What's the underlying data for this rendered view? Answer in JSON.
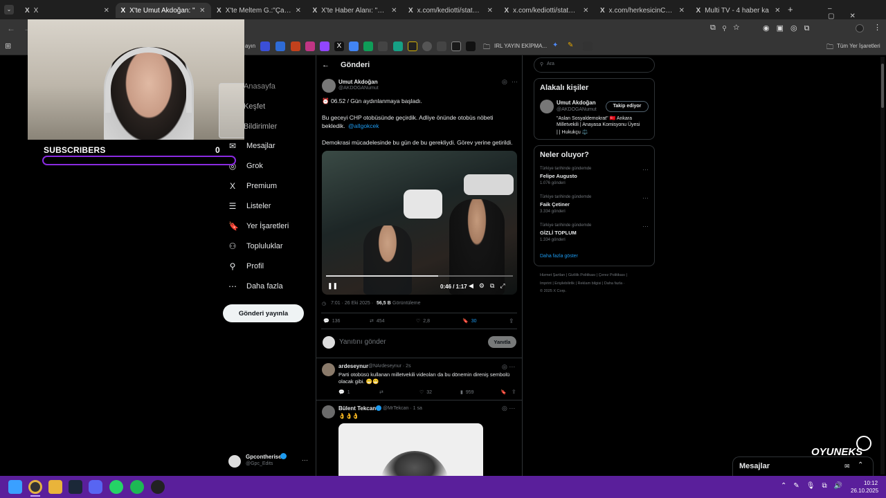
{
  "tabs": [
    {
      "label": "X"
    },
    {
      "label": "X'te Umut Akdoğan: \""
    },
    {
      "label": "X'te Meltem G.:\"Çağlayan"
    },
    {
      "label": "X'te Haber Alanı: \"CHP M"
    },
    {
      "label": "x.com/kediotti/status/19"
    },
    {
      "label": "x.com/kediotti/status/19"
    },
    {
      "label": "x.com/herkesicinCHP/sta"
    },
    {
      "label": "Multi TV - 4 haber ka"
    }
  ],
  "bookmarks": {
    "folder": "IRL YAYIN EKİPMA...",
    "all": "Tüm Yer İşaretleri",
    "truncated": "ayın"
  },
  "overlay": {
    "subscribers_label": "SUBSCRIBERS",
    "subscribers_count": "0",
    "brand": "OYUNEKS"
  },
  "sidebar": {
    "items": [
      {
        "label": "Anasayfa",
        "icon": "home-icon"
      },
      {
        "label": "Keşfet",
        "icon": "search-icon"
      },
      {
        "label": "Bildirimler",
        "icon": "bell-icon"
      },
      {
        "label": "Mesajlar",
        "icon": "mail-icon"
      },
      {
        "label": "Grok",
        "icon": "grok-icon"
      },
      {
        "label": "Premium",
        "icon": "x-icon"
      },
      {
        "label": "Listeler",
        "icon": "list-icon"
      },
      {
        "label": "Yer İşaretleri",
        "icon": "bookmark-icon"
      },
      {
        "label": "Topluluklar",
        "icon": "people-icon"
      },
      {
        "label": "Profil",
        "icon": "person-icon"
      },
      {
        "label": "Daha fazla",
        "icon": "more-icon"
      }
    ],
    "post_button": "Gönderi yayınla",
    "account": {
      "name": "Gpcontherise",
      "handle": "@Gpc_Edits"
    }
  },
  "header": {
    "title": "Gönderi"
  },
  "tweet": {
    "name": "Umut Akdoğan",
    "handle": "@AKDOGANumut",
    "line1": "⏰ 06.52 / Gün aydınlanmaya başladı.",
    "line2": "Bu geceyi CHP otobüsünde geçirdik. Adliye önünde otobüs nöbeti",
    "line3a": "bekledik.",
    "mention": "@alIgokcek",
    "line4": "Demokrasi mücadelesinde bu gün de bu gerekliydi. Görev yerine getirildi.",
    "video_time": "0:46 / 1:17",
    "video_progress": 0.6,
    "time": "7:01 · 26 Eki 2025 · ",
    "views": "56,5 B",
    "views_label": "Görüntüleme",
    "replies": "136",
    "retweets": "454",
    "likes": "2,8",
    "bookmarks": "30"
  },
  "reply_box": {
    "placeholder": "Yanıtını gönder",
    "button": "Yanıtla"
  },
  "replies": [
    {
      "name": "ardeseynur",
      "handle": "@NArdeseynur · 2s",
      "text1": "Parti otobüsü kullanan milletvekili videoları da bu dönemin direniş sembolü",
      "text2": "olacak gibi. 😁😁",
      "r": "1",
      "rt": "",
      "l": "32",
      "v": "959"
    },
    {
      "name": "Bülent Tekcan",
      "handle": "@MrTekcan · 1 sa",
      "text1": "👌👌👌"
    }
  ],
  "search": {
    "placeholder": "Ara"
  },
  "related": {
    "title": "Alakalı kişiler",
    "name": "Umut Akdoğan",
    "handle": "@AKDOGANumut",
    "button": "Takip ediyor",
    "bio1": "\"Aslan Sosyaldemokrat\" 🇹🇷 Ankara",
    "bio2": "Milletvekili | Anayasa Komisyonu Üyesi",
    "bio3": "| | Hukukçu ⚖️"
  },
  "trends": {
    "title": "Neler oluyor?",
    "items": [
      {
        "context": "Türkiye tarihinde gündemde",
        "name": "Felipe Augusto",
        "count": "1.076 gönderi"
      },
      {
        "context": "Türkiye tarihinde gündemde",
        "name": "Faik Çetiner",
        "count": "3.334 gönderi"
      },
      {
        "context": "Türkiye tarihinde gündemde",
        "name": "GİZLİ TOPLUM",
        "count": "1.334 gönderi"
      }
    ],
    "more": "Daha fazla göster"
  },
  "footer": {
    "l1": "Hizmet Şartları | Gizlilik Politikası | Çerez Politikası |",
    "l2": "Imprint | Erişilebilirlik | Reklam bilgisi | Daha fazla ·",
    "l3": "© 2025 X Corp."
  },
  "messages": {
    "label": "Mesajlar"
  },
  "clock": {
    "time": "10:12",
    "date": "26.10.2025"
  }
}
